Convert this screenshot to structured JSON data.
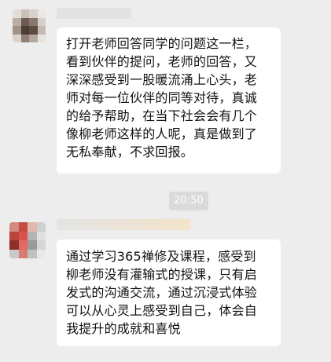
{
  "messages": [
    {
      "lines": [
        "打开老师回答同学的问题这一栏，",
        "看到伙伴的提问，老师的回答，又",
        "深深感受到一股暖流涌上心头，老",
        "师对每一位伙伴的同等对待，真诚",
        "的给予帮助，在当下社会会有几个",
        "像柳老师这样的人呢，真是做到了",
        "无私奉献，不求回报。"
      ]
    },
    {
      "lines": [
        "通过学习365禅修及课程，感受到",
        "柳老师没有灌输式的授课，只有启",
        "发式的沟通交流，通过沉浸式体验",
        "可以从心灵上感受到自己，体会自",
        "我提升的成就和喜悦"
      ]
    }
  ],
  "timestamp": "20:50",
  "colors": {
    "background": "#ededed",
    "bubble": "#ffffff",
    "text": "#111111",
    "timestamp_bg": "#dadada"
  }
}
